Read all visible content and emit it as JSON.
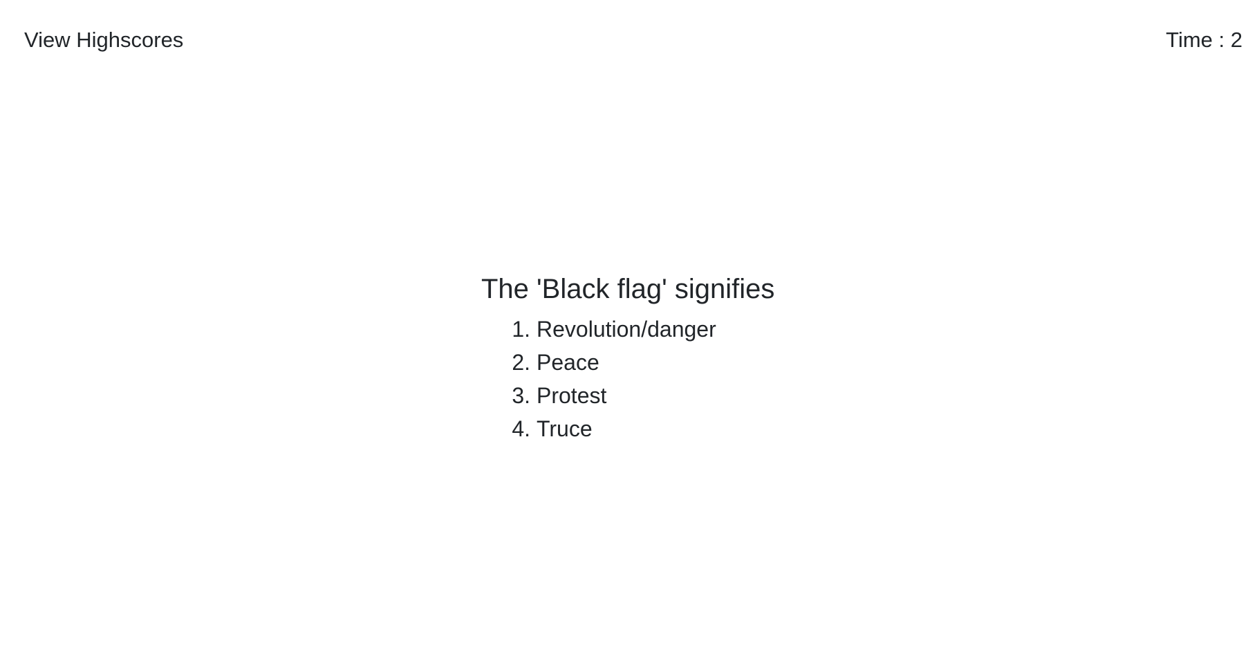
{
  "header": {
    "highscores_label": "View Highscores",
    "timer_label": "Time : ",
    "timer_value": "2"
  },
  "quiz": {
    "question": "The 'Black flag' signifies",
    "choices": [
      {
        "number": "1.",
        "text": "Revolution/danger"
      },
      {
        "number": "2.",
        "text": "Peace"
      },
      {
        "number": "3.",
        "text": "Protest"
      },
      {
        "number": "4.",
        "text": "Truce"
      }
    ]
  }
}
